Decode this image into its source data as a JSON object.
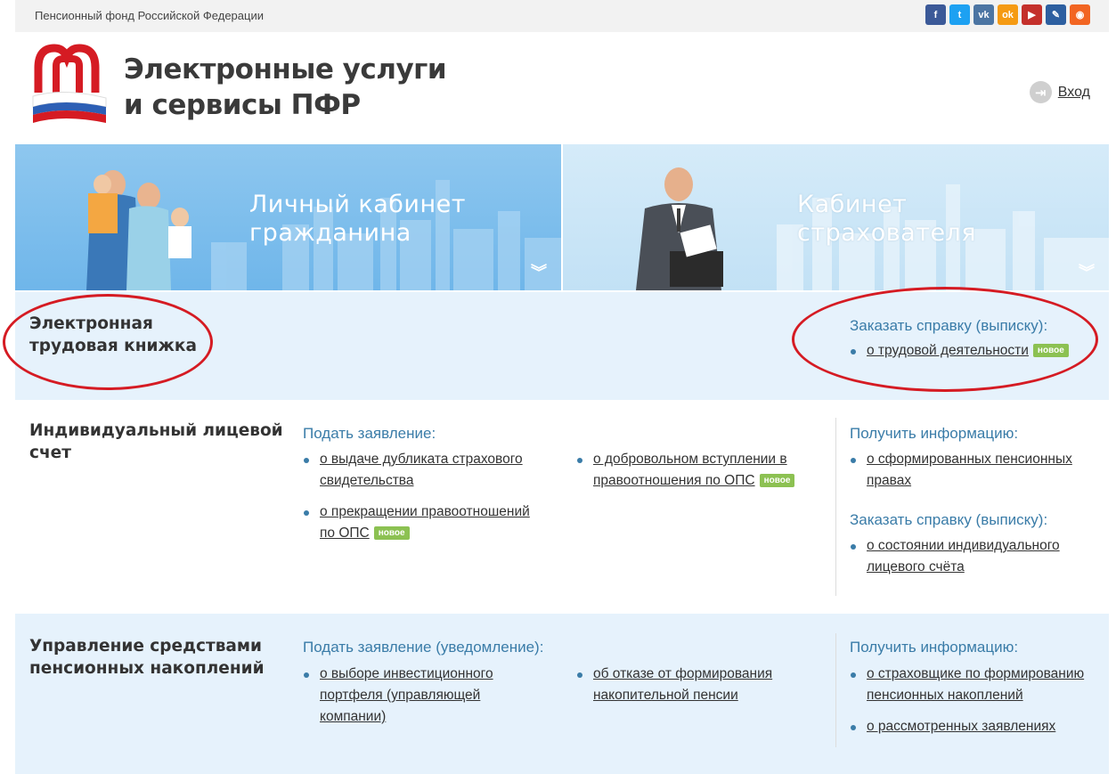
{
  "topbar": {
    "org_name": "Пенсионный фонд Российской Федерации",
    "socials": [
      {
        "icon": "facebook-icon",
        "glyph": "f",
        "color": "#3b5998"
      },
      {
        "icon": "twitter-icon",
        "glyph": "t",
        "color": "#1da1f2"
      },
      {
        "icon": "vk-icon",
        "glyph": "vk",
        "color": "#4c75a3"
      },
      {
        "icon": "odnoklassniki-icon",
        "glyph": "ok",
        "color": "#f59a12"
      },
      {
        "icon": "youtube-icon",
        "glyph": "▶",
        "color": "#c4302b"
      },
      {
        "icon": "livejournal-icon",
        "glyph": "✎",
        "color": "#2d5fa0"
      },
      {
        "icon": "rss-icon",
        "glyph": "◉",
        "color": "#f26522"
      }
    ]
  },
  "header": {
    "title_line1": "Электронные услуги",
    "title_line2": "и сервисы ПФР",
    "login_label": "Вход"
  },
  "banners": {
    "citizen": {
      "line1": "Личный кабинет",
      "line2": "гражданина"
    },
    "insurer": {
      "line1": "Кабинет",
      "line2": "страхователя"
    }
  },
  "badge_new": "новое",
  "sections": {
    "labor_book": {
      "title_line1": "Электронная",
      "title_line2": "трудовая книжка",
      "order_head": "Заказать справку (выписку):",
      "order_item": "о трудовой деятельности"
    },
    "personal_account": {
      "title_line1": "Индивидуальный лицевой",
      "title_line2": "счет",
      "apply_head": "Подать заявление:",
      "apply_items": [
        {
          "line1": "о выдаче дубликата страхового",
          "line2": "свидетельства"
        },
        {
          "line1": "о прекращении правоотношений",
          "line2": "по ОПС"
        },
        {
          "line1": "о добровольном вступлении в",
          "line2": "правоотношения по ОПС"
        }
      ],
      "info_head": "Получить информацию:",
      "info_item": {
        "line1": "о сформированных пенсионных",
        "line2": "правах"
      },
      "order_head": "Заказать справку (выписку):",
      "order_item": {
        "line1": "о состоянии индивидуального",
        "line2": "лицевого счёта"
      }
    },
    "pension_savings": {
      "title_line1": "Управление средствами",
      "title_line2": "пенсионных накоплений",
      "apply_head": "Подать заявление (уведомление):",
      "apply_items": [
        {
          "line1": "о выборе инвестиционного",
          "line2": "портфеля (управляющей",
          "line3": "компании)"
        },
        {
          "line1": "об отказе от формирования",
          "line2": "накопительной пенсии"
        }
      ],
      "info_head": "Получить информацию:",
      "info_items": [
        {
          "line1": "о страховщике по формированию",
          "line2": "пенсионных накоплений"
        },
        {
          "line1": "о рассмотренных заявлениях"
        }
      ]
    }
  },
  "colors": {
    "link_heading": "#3a7ca8",
    "badge_green": "#8cc152",
    "section_bg": "#e6f2fc",
    "annotation_red": "#d51b23"
  }
}
